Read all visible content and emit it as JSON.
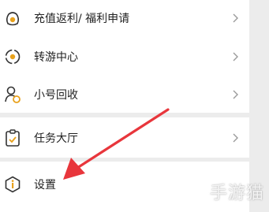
{
  "menu": {
    "items": [
      {
        "label": "充值返利/ 福利申请",
        "icon": "money-bag-icon",
        "has_chevron": true
      },
      {
        "label": "转游中心",
        "icon": "transfer-game-icon",
        "has_chevron": true
      },
      {
        "label": "小号回收",
        "icon": "account-recycle-icon",
        "has_chevron": true
      },
      {
        "label": "任务大厅",
        "icon": "task-checklist-icon",
        "has_chevron": true
      },
      {
        "label": "设置",
        "icon": "settings-info-icon",
        "has_chevron": false
      }
    ]
  },
  "annotation": {
    "arrow_color": "#e8363c",
    "icon_accent": "#e8a11c"
  },
  "watermark": {
    "text": "手游猫"
  }
}
